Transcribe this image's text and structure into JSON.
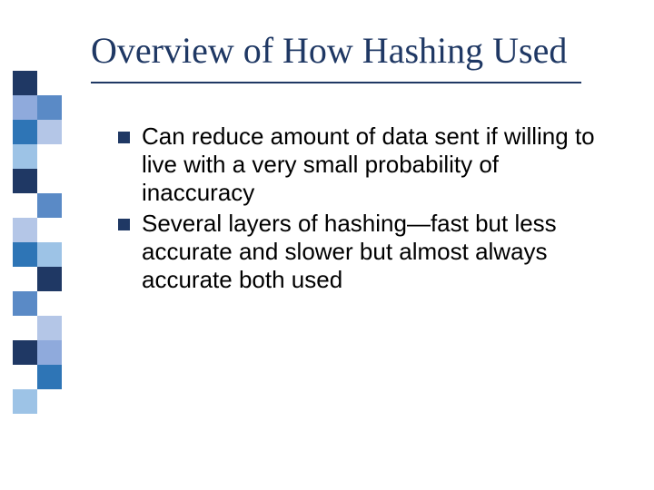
{
  "title": "Overview of How Hashing Used",
  "bullets": [
    "Can reduce amount of data sent if willing to live with a very small probability of inaccuracy",
    "Several layers of hashing—fast but less accurate and slower but almost always accurate both used"
  ],
  "colors": {
    "title": "#1f3864",
    "bullet": "#1f3864",
    "text": "#000000"
  }
}
